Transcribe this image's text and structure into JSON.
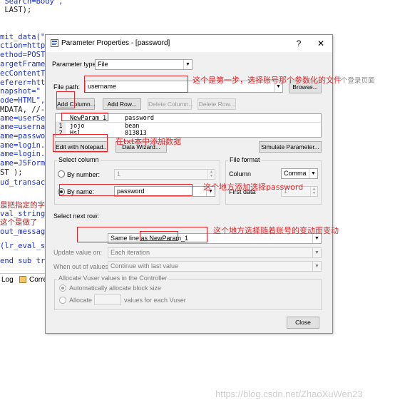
{
  "code": {
    "lines": [
      {
        "text": " Search=Body\",",
        "color": "c-blue"
      },
      {
        "text": " LAST);",
        "color": "c-black"
      },
      {
        "text": "mit_data(\"",
        "color": "c-blue"
      },
      {
        "text": "ction=http:",
        "color": "c-blue"
      },
      {
        "text": "ethod=POST\"",
        "color": "c-blue"
      },
      {
        "text": "argetFrame=",
        "color": "c-blue"
      },
      {
        "text": "ecContentTyp",
        "color": "c-blue"
      },
      {
        "text": "eferer=http",
        "color": "c-blue"
      },
      {
        "text": "napshot=\"",
        "color": "c-blue"
      },
      {
        "text": "ode=HTML\",",
        "color": "c-blue"
      },
      {
        "text": "MDATA, //-",
        "color": "c-black"
      },
      {
        "text": "ame=userSes",
        "color": "c-blue"
      },
      {
        "text": "ame=usernam",
        "color": "c-blue"
      },
      {
        "text": "ame=passwor",
        "color": "c-blue"
      },
      {
        "text": "ame=login.x",
        "color": "c-blue"
      },
      {
        "text": "ame=login.y",
        "color": "c-blue"
      },
      {
        "text": "ame=JSFormS",
        "color": "c-blue"
      },
      {
        "text": "ST );",
        "color": "c-black"
      },
      {
        "text": "ud_transacti",
        "color": "c-blue"
      },
      {
        "text": "是把指定的字",
        "color": "c-red"
      },
      {
        "text": "val_string(",
        "color": "c-blue"
      },
      {
        "text": "这个是做了",
        "color": "c-red"
      },
      {
        "text": "out_message",
        "color": "c-blue"
      },
      {
        "text": "(lr_eval_s",
        "color": "c-blue"
      },
      {
        "text": "end sub tra",
        "color": "c-blue"
      }
    ],
    "status_tab_1": "Log",
    "status_tab_2": "Corre"
  },
  "dialog": {
    "title": "Parameter Properties - [password]",
    "help_btn": "?",
    "close_btn": "✕",
    "param_type_label": "Parameter type:",
    "param_type_value": "File",
    "file_path_label": "File path:",
    "file_path_value": "username",
    "browse_btn": "Browse...",
    "add_column_btn": "Add Column...",
    "add_row_btn": "Add Row...",
    "delete_column_btn": "Delete Column...",
    "delete_row_btn": "Delete Row...",
    "table": {
      "headers": [
        "NewParam_1",
        "password"
      ],
      "rows": [
        {
          "num": "1",
          "cells": [
            "jojo",
            "bean"
          ]
        },
        {
          "num": "2",
          "cells": [
            "Hsl",
            "813813"
          ]
        }
      ]
    },
    "edit_notepad_btn": "Edit with Notepad...",
    "data_wizard_btn": "Data Wizard...",
    "simulate_btn": "Simulate Parameter...",
    "select_column_title": "Select column",
    "by_number_label": "By number:",
    "by_number_value": "1",
    "by_name_label": "By name:",
    "by_name_value": "password",
    "file_format_title": "File format",
    "column_label": "Column",
    "column_value": "Comma",
    "first_data_label": "First data",
    "first_data_value": "1",
    "select_next_row_label": "Select next row:",
    "select_next_row_value": "Same line as NewParam_1",
    "update_value_label": "Update value on:",
    "update_value_value": "Each iteration",
    "when_out_label": "When out of values:",
    "when_out_value": "Continue with last value",
    "allocate_title": "Allocate Vuser values in the Controller",
    "auto_allocate_label": "Automatically allocate block size",
    "allocate_label": "Allocate",
    "allocate_suffix": "values for each Vuser",
    "close_btn_label": "Close"
  },
  "annotations": {
    "step1": "这个是第一步，选择账号那个参数化的文件",
    "add_data": "在txt本中添加数据",
    "select_password": "这个地方添加选择password",
    "follow_account": "这个地方选择随着账号的变动而变动"
  },
  "hint_text": "个登录页面",
  "watermark": "https://blog.csdn.net/ZhaoXuWen23",
  "colors": {
    "annotation_red": "#e3262a",
    "dialog_bg": "#f0f0f0"
  }
}
